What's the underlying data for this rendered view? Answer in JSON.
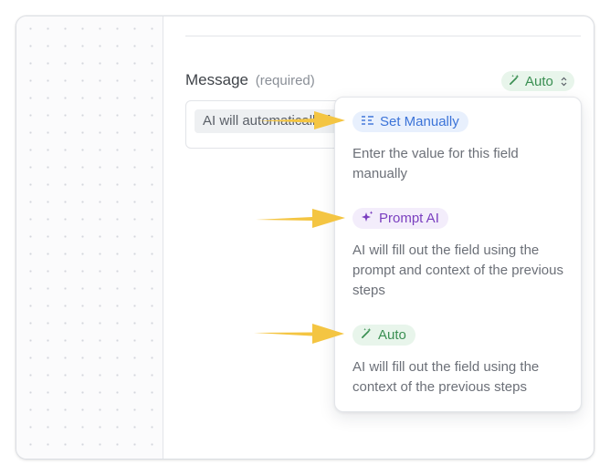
{
  "field": {
    "label": "Message",
    "required_note": "(required)",
    "value_preview": "AI will automatically f"
  },
  "mode_select": {
    "value": "Auto",
    "icon": "magic-wand-icon"
  },
  "dropdown": {
    "options": [
      {
        "label": "Set Manually",
        "icon": "list-lines-icon",
        "description": "Enter the value for this field manually"
      },
      {
        "label": "Prompt AI",
        "icon": "sparkle-icon",
        "description": "AI will fill out the field using the prompt and context of the previous steps"
      },
      {
        "label": "Auto",
        "icon": "magic-wand-icon",
        "description": "AI will fill out the field using the context of the previous steps"
      }
    ]
  },
  "colors": {
    "manual": "#3b73d8",
    "prompt": "#7a3fbf",
    "auto": "#3a8f52",
    "arrow": "#f4c542"
  }
}
